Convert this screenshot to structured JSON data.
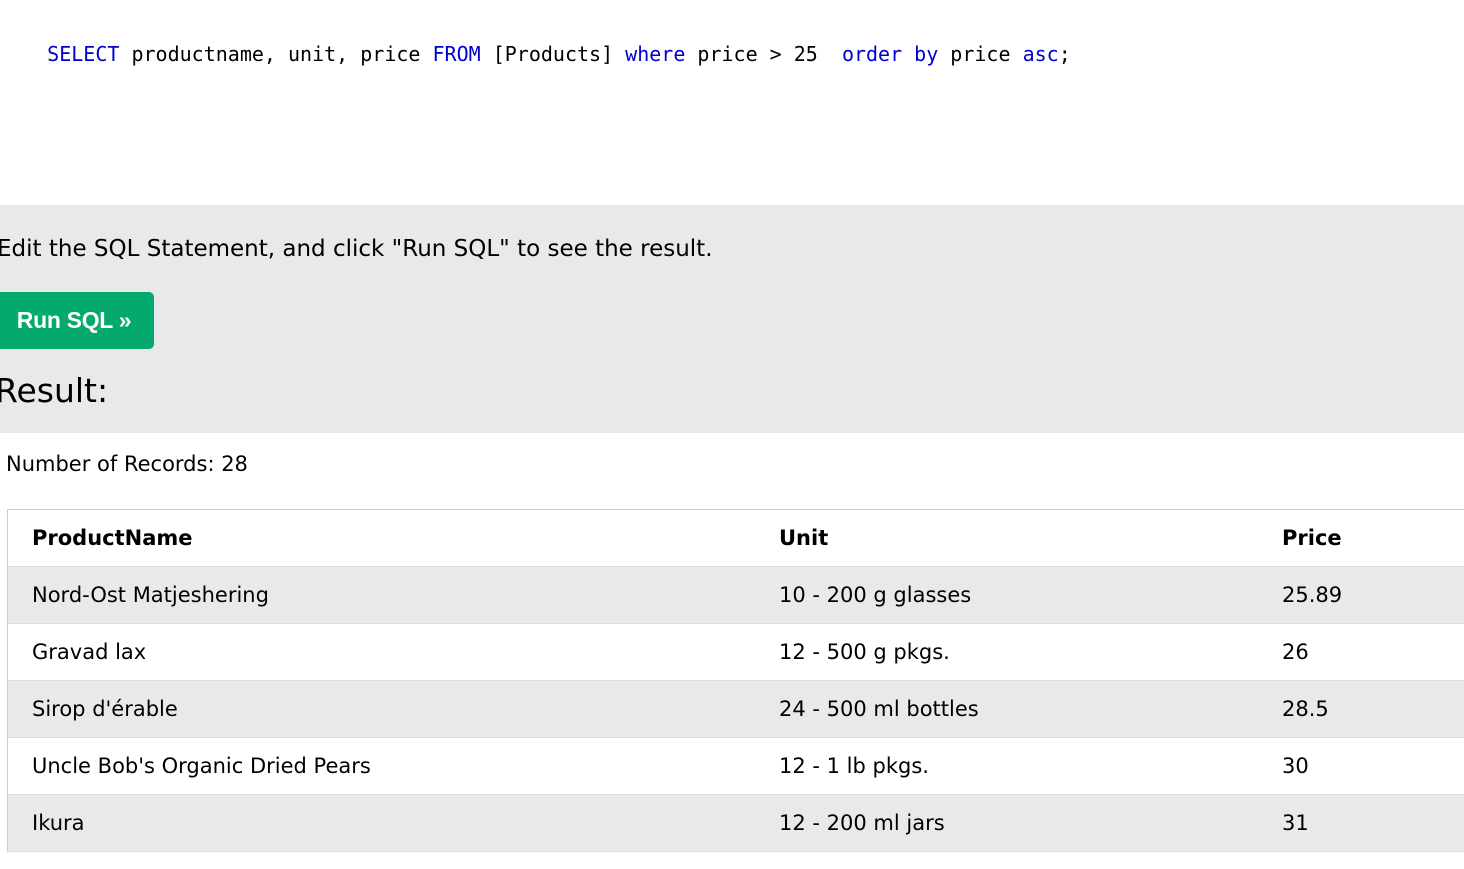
{
  "editor": {
    "tokens": [
      {
        "text": "SELECT",
        "kind": "kw"
      },
      {
        "text": " productname, unit, price ",
        "kind": "txt"
      },
      {
        "text": "FROM",
        "kind": "kw"
      },
      {
        "text": " [Products] ",
        "kind": "txt"
      },
      {
        "text": "where",
        "kind": "kw"
      },
      {
        "text": " price > 25  ",
        "kind": "txt"
      },
      {
        "text": "order by",
        "kind": "kw"
      },
      {
        "text": " price ",
        "kind": "txt"
      },
      {
        "text": "asc",
        "kind": "kw"
      },
      {
        "text": ";",
        "kind": "txt"
      }
    ]
  },
  "panel": {
    "instructions": "Edit the SQL Statement, and click \"Run SQL\" to see the result.",
    "run_button_label": "Run SQL »",
    "result_heading": "Result:"
  },
  "results": {
    "record_count_text": "Number of Records: 28",
    "columns": [
      "ProductName",
      "Unit",
      "Price"
    ],
    "rows": [
      [
        "Nord-Ost Matjeshering",
        "10 - 200 g glasses",
        "25.89"
      ],
      [
        "Gravad lax",
        "12 - 500 g pkgs.",
        "26"
      ],
      [
        "Sirop d'érable",
        "24 - 500 ml bottles",
        "28.5"
      ],
      [
        "Uncle Bob's Organic Dried Pears",
        "12 - 1 lb pkgs.",
        "30"
      ],
      [
        "Ikura",
        "12 - 200 ml jars",
        "31"
      ]
    ]
  },
  "colors": {
    "keyword": "#0000cd",
    "button": "#04aa6d",
    "panel_background": "#e7e9eb"
  }
}
